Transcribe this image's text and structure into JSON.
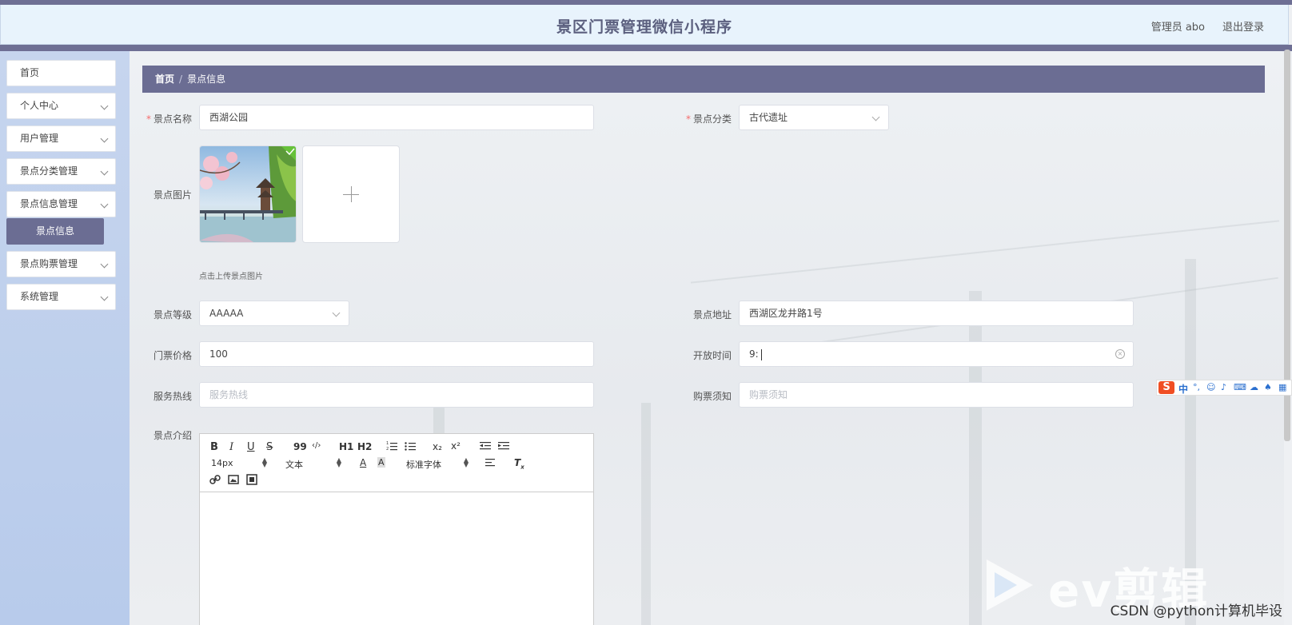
{
  "header": {
    "title": "景区门票管理微信小程序",
    "user": "管理员 abo",
    "logout": "退出登录"
  },
  "sidebar": {
    "items": [
      {
        "label": "首页",
        "has_submenu": false
      },
      {
        "label": "个人中心",
        "has_submenu": true
      },
      {
        "label": "用户管理",
        "has_submenu": true
      },
      {
        "label": "景点分类管理",
        "has_submenu": true
      },
      {
        "label": "景点信息管理",
        "has_submenu": true
      },
      {
        "label": "景点购票管理",
        "has_submenu": true
      },
      {
        "label": "系统管理",
        "has_submenu": true
      }
    ],
    "active_sub": "景点信息"
  },
  "breadcrumb": {
    "home": "首页",
    "separator": "/",
    "current": "景点信息"
  },
  "form": {
    "name": {
      "label": "景点名称",
      "value": "西湖公园",
      "required": true
    },
    "category": {
      "label": "景点分类",
      "value": "古代遗址",
      "required": true
    },
    "image": {
      "label": "景点图片",
      "tip": "点击上传景点图片"
    },
    "level": {
      "label": "景点等级",
      "value": "AAAAA"
    },
    "address": {
      "label": "景点地址",
      "value": "西湖区龙井路1号"
    },
    "price": {
      "label": "门票价格",
      "value": "100"
    },
    "open_time": {
      "label": "开放时间",
      "value": "9:"
    },
    "hotline": {
      "label": "服务热线",
      "placeholder": "服务热线"
    },
    "notice": {
      "label": "购票须知",
      "placeholder": "购票须知"
    },
    "intro": {
      "label": "景点介绍"
    }
  },
  "editor": {
    "size": "14px",
    "header": "文本",
    "font": "标准字体",
    "bold": "B",
    "italic": "I",
    "underline": "U",
    "strike": "S",
    "quote": "99",
    "code": "‹/›",
    "h1": "H1",
    "h2": "H2",
    "sub": "x₂",
    "sup": "x²"
  },
  "ime": {
    "lang": "中"
  },
  "watermark": {
    "brand": "ev剪辑",
    "csdn": "CSDN @python计算机毕设"
  },
  "colors": {
    "primary": "#6b6d93",
    "header_bg": "#e8f3fc",
    "required": "#f56c6c"
  }
}
